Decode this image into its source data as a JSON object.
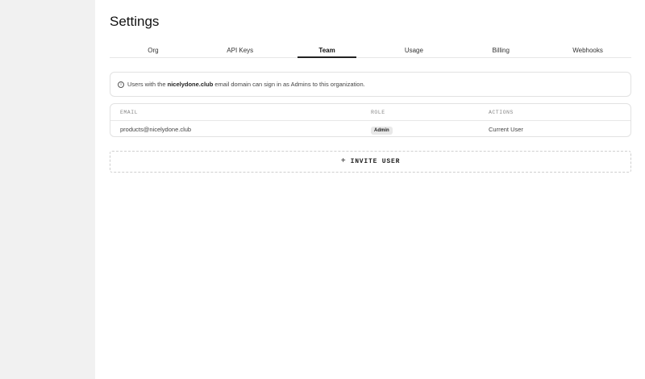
{
  "page": {
    "title": "Settings"
  },
  "tabs": [
    {
      "label": "Org"
    },
    {
      "label": "API Keys"
    },
    {
      "label": "Team",
      "active": true
    },
    {
      "label": "Usage"
    },
    {
      "label": "Billing"
    },
    {
      "label": "Webhooks"
    }
  ],
  "info": {
    "icon": "info-icon",
    "prefix": "Users with the ",
    "domain": "nicelydone.club",
    "suffix": " email domain can sign in as Admins to this organization."
  },
  "table": {
    "columns": [
      "EMAIL",
      "ROLE",
      "ACTIONS"
    ],
    "rows": [
      {
        "email": "products@nicelydone.club",
        "role": "Admin",
        "action": "Current User"
      }
    ]
  },
  "invite": {
    "icon": "plus-icon",
    "label": "INVITE USER"
  }
}
